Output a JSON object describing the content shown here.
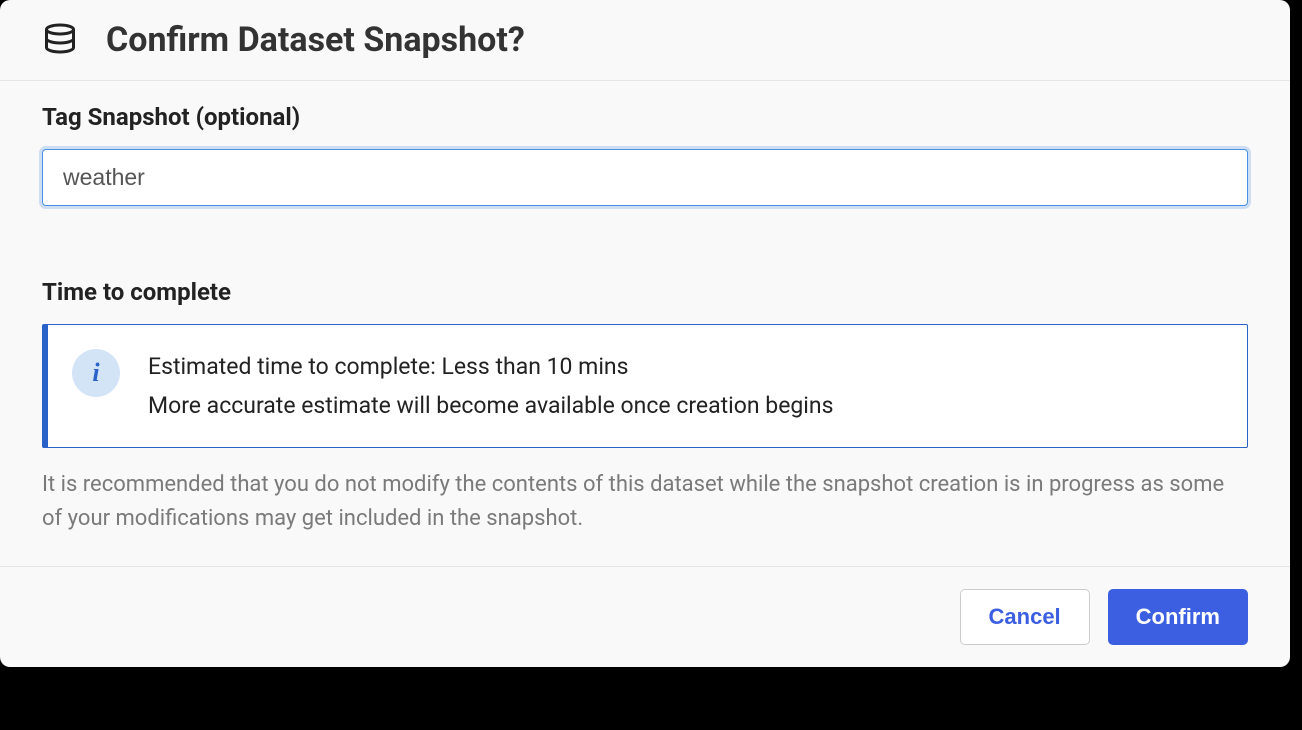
{
  "header": {
    "title": "Confirm Dataset Snapshot?"
  },
  "tag_section": {
    "label": "Tag Snapshot (optional)",
    "value": "weather"
  },
  "time_section": {
    "label": "Time to complete",
    "info_line1": "Estimated time to complete: Less than 10 mins",
    "info_line2": "More accurate estimate will become available once creation begins",
    "helper": "It is recommended that you do not modify the contents of this dataset while the snapshot creation is in progress as some of your modifications may get included in the snapshot."
  },
  "footer": {
    "cancel": "Cancel",
    "confirm": "Confirm"
  }
}
